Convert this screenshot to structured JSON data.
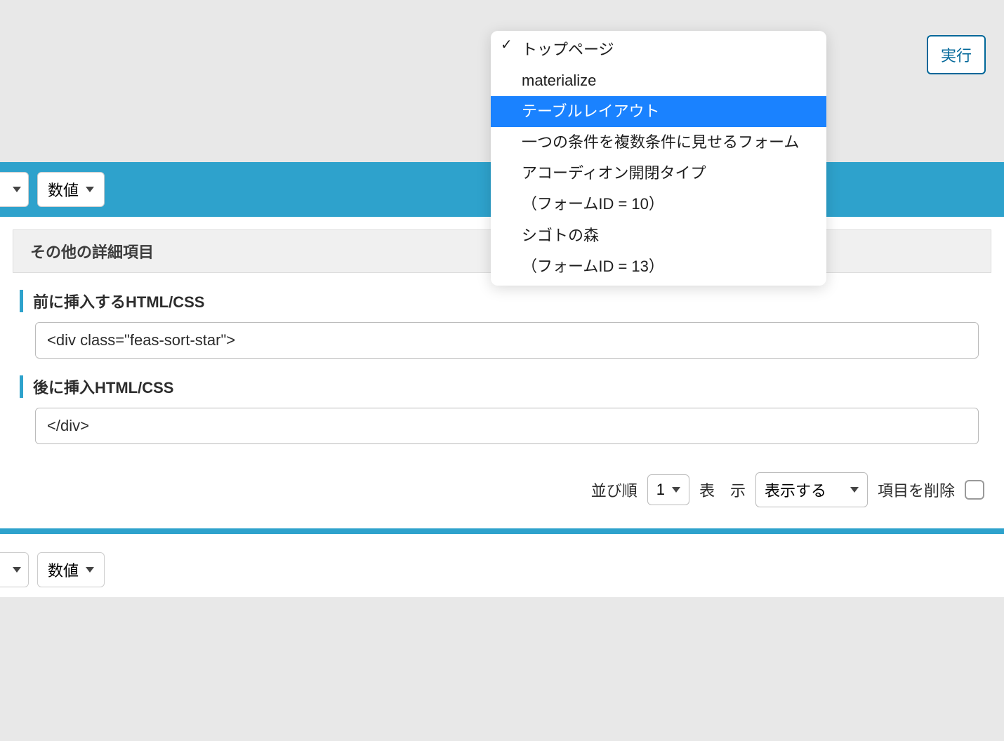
{
  "execute_button": "実行",
  "dropdown": {
    "items": [
      {
        "label": "トップページ",
        "checked": true,
        "highlighted": false
      },
      {
        "label": "materialize",
        "checked": false,
        "highlighted": false
      },
      {
        "label": "テーブルレイアウト",
        "checked": false,
        "highlighted": true
      },
      {
        "label": "一つの条件を複数条件に見せるフォーム",
        "checked": false,
        "highlighted": false
      },
      {
        "label": "アコーディオン開閉タイプ",
        "checked": false,
        "highlighted": false
      },
      {
        "label": "（フォームID = 10）",
        "checked": false,
        "highlighted": false
      },
      {
        "label": "シゴトの森",
        "checked": false,
        "highlighted": false
      },
      {
        "label": "（フォームID = 13）",
        "checked": false,
        "highlighted": false
      }
    ]
  },
  "top_select_numeric": "数値",
  "section_header": "その他の詳細項目",
  "field_before": {
    "label": "前に挿入するHTML/CSS",
    "value": "<div class=\"feas-sort-star\">"
  },
  "field_after": {
    "label": "後に挿入HTML/CSS",
    "value": "</div>"
  },
  "bottom_controls": {
    "sort_label": "並び順",
    "sort_value": "1",
    "display_label": "表　示",
    "display_value": "表示する",
    "delete_label": "項目を削除"
  },
  "lower_select_numeric": "数値"
}
